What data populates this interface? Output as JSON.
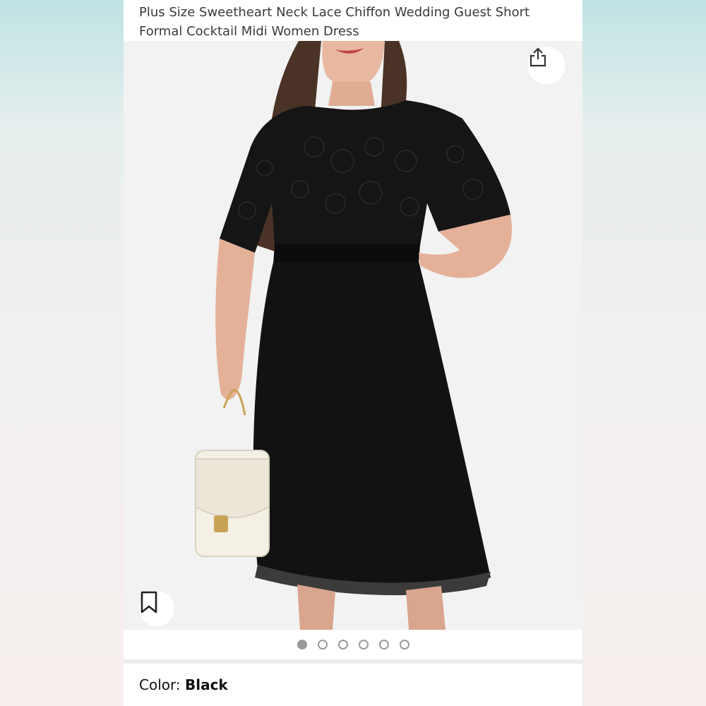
{
  "product": {
    "title": "Plus Size Sweetheart Neck Lace Chiffon Wedding Guest Short Formal Cocktail Midi Women Dress"
  },
  "gallery": {
    "image_count": 6,
    "active_index": 0,
    "share_icon": "share-icon",
    "save_icon": "bookmark-icon"
  },
  "variation": {
    "label": "Color:",
    "value": "Black"
  },
  "colors": {
    "dress": "#121212",
    "background": "#f2f2f2",
    "dot_active": "#9a9a9a"
  }
}
